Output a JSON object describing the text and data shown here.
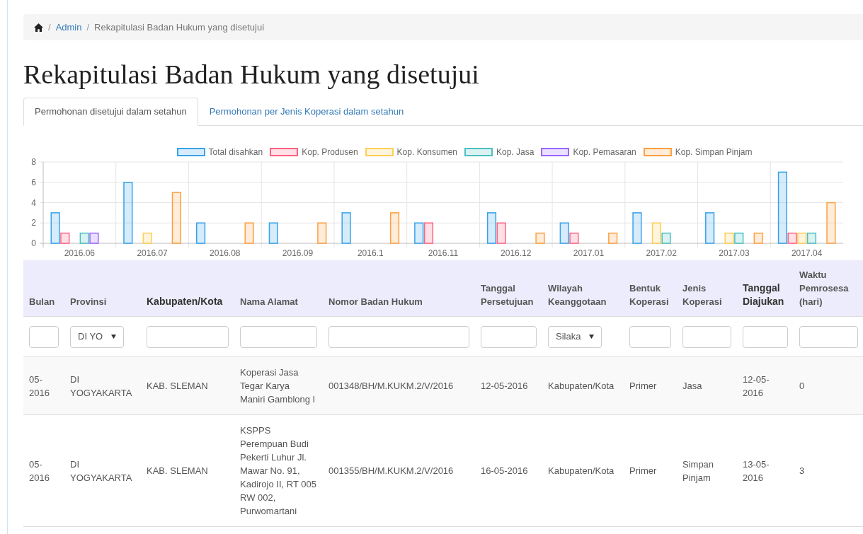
{
  "breadcrumb": {
    "items": [
      {
        "separator": "/",
        "label": "Admin",
        "link": true
      },
      {
        "separator": "/",
        "label": "Rekapitulasi Badan Hukum yang disetujui",
        "link": false
      }
    ]
  },
  "title": "Rekapitulasi Badan Hukum yang disetujui",
  "tabs": [
    {
      "label": "Permohonan disetujui dalam setahun",
      "selected": true
    },
    {
      "label": "Permohonan per Jenis Koperasi dalam setahun",
      "selected": false
    }
  ],
  "chart_data": {
    "type": "bar",
    "categories": [
      "2016.06",
      "2016.07",
      "2016.08",
      "2016.09",
      "2016.1",
      "2016.11",
      "2016.12",
      "2017.01",
      "2017.02",
      "2017.03",
      "2017.04"
    ],
    "ylim": [
      0,
      8
    ],
    "grid": true,
    "yticks": [
      0,
      2,
      4,
      6,
      8
    ],
    "series": [
      {
        "name": "Total disahkan",
        "color": "#36a2eb",
        "values": [
          3,
          6,
          2,
          2,
          3,
          2,
          3,
          2,
          3,
          3,
          7
        ]
      },
      {
        "name": "Kop. Produsen",
        "color": "#ff6384",
        "values": [
          1,
          0,
          0,
          0,
          0,
          2,
          2,
          1,
          0,
          0,
          1
        ]
      },
      {
        "name": "Kop. Konsumen",
        "color": "#ffce56",
        "values": [
          0,
          1,
          0,
          0,
          0,
          0,
          0,
          0,
          2,
          1,
          1
        ]
      },
      {
        "name": "Kop. Jasa",
        "color": "#4bc0c0",
        "values": [
          1,
          0,
          0,
          0,
          0,
          0,
          0,
          0,
          1,
          1,
          1
        ]
      },
      {
        "name": "Kop. Pemasaran",
        "color": "#9966ff",
        "values": [
          1,
          0,
          0,
          0,
          0,
          0,
          0,
          0,
          0,
          0,
          0
        ]
      },
      {
        "name": "Kop. Simpan Pinjam",
        "color": "#ff9f40",
        "values": [
          0,
          5,
          2,
          2,
          3,
          0,
          1,
          1,
          0,
          1,
          4
        ]
      }
    ]
  },
  "table": {
    "columns": [
      {
        "label": "Bulan",
        "highlighted": false,
        "filter": {
          "kind": "text"
        }
      },
      {
        "label": "Provinsi",
        "highlighted": false,
        "filter": {
          "kind": "select",
          "value": "DI YO"
        }
      },
      {
        "label": "Kabupaten/Kota",
        "highlighted": true,
        "filter": {
          "kind": "text"
        }
      },
      {
        "label": "Nama Alamat",
        "highlighted": false,
        "filter": {
          "kind": "text"
        }
      },
      {
        "label": "Nomor Badan Hukum",
        "highlighted": false,
        "filter": {
          "kind": "text"
        }
      },
      {
        "label": "Tanggal Persetujuan",
        "highlighted": false,
        "filter": {
          "kind": "text"
        }
      },
      {
        "label": "Wilayah Keanggotaan",
        "highlighted": false,
        "filter": {
          "kind": "select",
          "value": "Silaka"
        }
      },
      {
        "label": "Bentuk Koperasi",
        "highlighted": false,
        "filter": {
          "kind": "text"
        }
      },
      {
        "label": "Jenis Koperasi",
        "highlighted": false,
        "filter": {
          "kind": "text"
        }
      },
      {
        "label": "Tanggal Diajukan",
        "highlighted": true,
        "filter": {
          "kind": "text"
        }
      },
      {
        "label": "Waktu Pemrosesa (hari)",
        "highlighted": false,
        "filter": {
          "kind": "text"
        }
      }
    ],
    "rows": [
      [
        "05-2016",
        "DI YOGYAKARTA",
        "KAB. SLEMAN",
        "Koperasi Jasa Tegar Karya Maniri Gamblong I",
        "001348/BH/M.KUKM.2/V/2016",
        "12-05-2016",
        "Kabupaten/Kota",
        "Primer",
        "Jasa",
        "12-05-2016",
        "0"
      ],
      [
        "05-2016",
        "DI YOGYAKARTA",
        "KAB. SLEMAN",
        "KSPPS Perempuan Budi Pekerti Luhur Jl. Mawar No. 91, Kadirojo II, RT 005 RW 002, Purwomartani",
        "001355/BH/M.KUKM.2/V/2016",
        "16-05-2016",
        "Kabupaten/Kota",
        "Primer",
        "Simpan Pinjam",
        "13-05-2016",
        "3"
      ]
    ]
  }
}
